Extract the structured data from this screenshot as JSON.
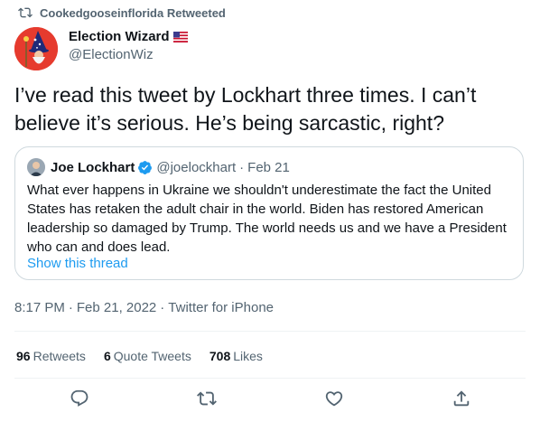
{
  "retweet_context": {
    "icon": "retweet-icon",
    "text": "Cookedgooseinflorida Retweeted"
  },
  "author": {
    "name": "Election Wizard",
    "flag_icon": "us-flag-icon",
    "handle": "@ElectionWiz",
    "avatar_color": "#e63b2e"
  },
  "tweet": {
    "text": "I’ve read this tweet by Lockhart three times. I can’t believe it’s serious. He’s being sarcastic, right?"
  },
  "quoted_tweet": {
    "name": "Joe Lockhart",
    "verified_icon": "verified-badge-icon",
    "handle": "@joelockhart",
    "separator": "·",
    "date": "Feb 21",
    "text": "What ever happens in Ukraine we shouldn't underestimate the fact the United States has retaken the adult chair in the world. Biden has restored American leadership so damaged by Trump. The world needs us and we have a President who can and does lead.",
    "show_thread": "Show this thread"
  },
  "meta": {
    "time": "8:17 PM",
    "sep1": "·",
    "date": "Feb 21, 2022",
    "sep2": "·",
    "source": "Twitter for iPhone"
  },
  "stats": {
    "retweets_count": "96",
    "retweets_label": "Retweets",
    "quotes_count": "6",
    "quotes_label": "Quote Tweets",
    "likes_count": "708",
    "likes_label": "Likes"
  },
  "actions": {
    "reply_icon": "reply-icon",
    "retweet_icon": "retweet-icon",
    "like_icon": "like-icon",
    "share_icon": "share-icon"
  },
  "colors": {
    "accent": "#1d9bf0",
    "secondary_text": "#536471",
    "border": "#cfd9de"
  }
}
